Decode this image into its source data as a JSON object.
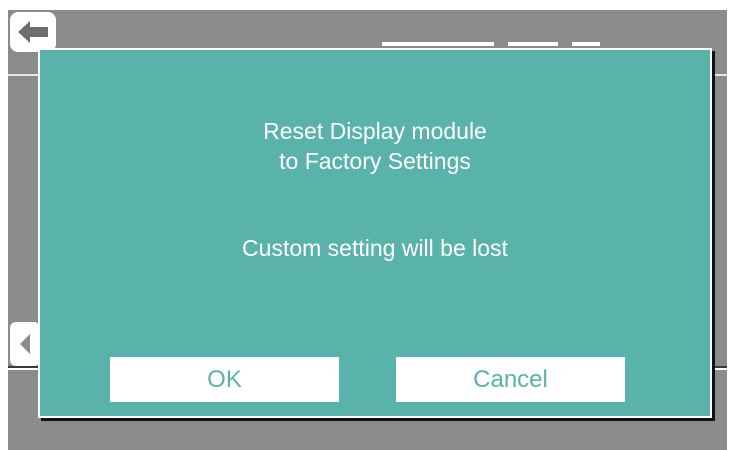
{
  "background": {
    "back_icon": "left-arrow-icon",
    "side_icon": "chevron-left-icon"
  },
  "dialog": {
    "title_line1": "Reset Display module",
    "title_line2": "to Factory Settings",
    "message": "Custom setting will be lost",
    "ok_label": "OK",
    "cancel_label": "Cancel"
  },
  "colors": {
    "dialog_bg": "#59b3ab",
    "screen_bg": "#8b8b8c",
    "button_bg": "#ffffff",
    "button_text": "#59b3ab",
    "text": "#ffffff"
  }
}
